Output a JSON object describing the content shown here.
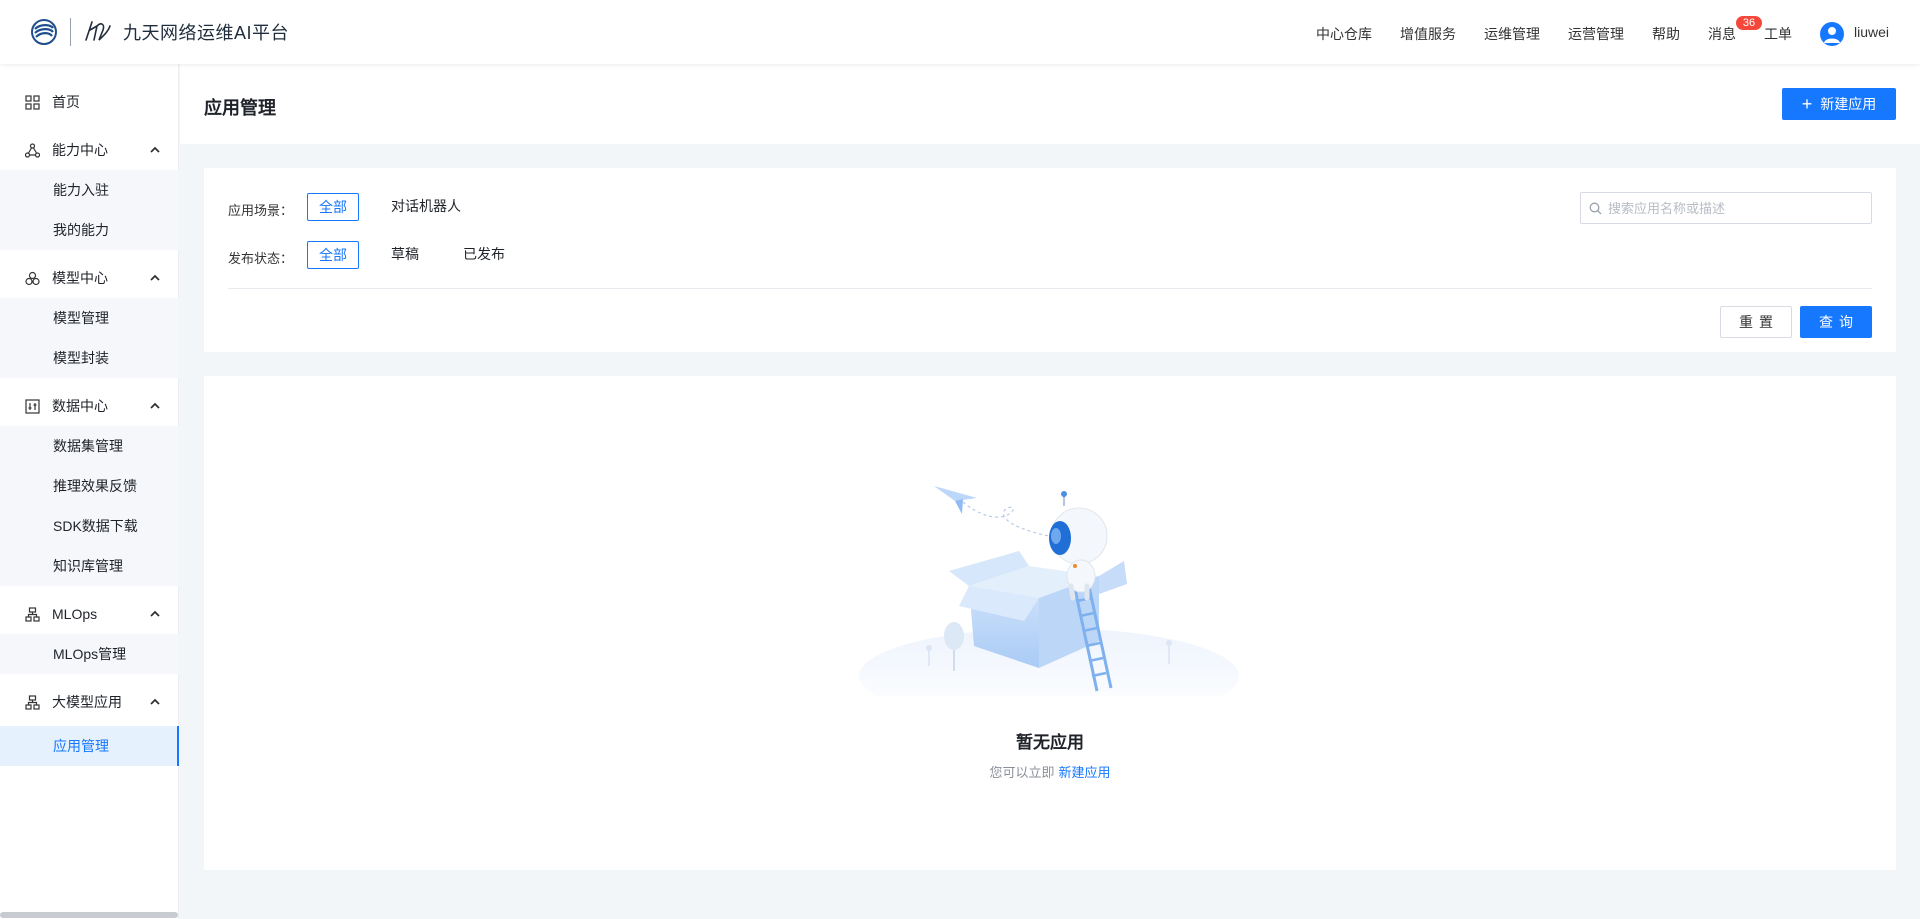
{
  "header": {
    "logo_text": "九天网络运维AI平台",
    "nav": [
      {
        "label": "中心仓库"
      },
      {
        "label": "增值服务"
      },
      {
        "label": "运维管理"
      },
      {
        "label": "运营管理"
      },
      {
        "label": "帮助"
      },
      {
        "label": "消息"
      },
      {
        "label": "工单"
      }
    ],
    "message_badge": "36",
    "username": "liuwei"
  },
  "sidebar": {
    "home": "首页",
    "groups": [
      {
        "label": "能力中心",
        "icon": "share-nodes-icon",
        "items": [
          "能力入驻",
          "我的能力"
        ]
      },
      {
        "label": "模型中心",
        "icon": "circles-icon",
        "items": [
          "模型管理",
          "模型封装"
        ]
      },
      {
        "label": "数据中心",
        "icon": "data-sliders-icon",
        "items": [
          "数据集管理",
          "推理效果反馈",
          "SDK数据下载",
          "知识库管理"
        ]
      },
      {
        "label": "MLOps",
        "icon": "hierarchy-icon",
        "items": [
          "MLOps管理"
        ]
      },
      {
        "label": "大模型应用",
        "icon": "hierarchy-icon",
        "items": [
          "应用管理"
        ]
      }
    ],
    "active_item": "应用管理"
  },
  "page": {
    "title": "应用管理",
    "new_button": "新建应用"
  },
  "filters": {
    "scene_label": "应用场景：",
    "scene_options": [
      "全部",
      "对话机器人"
    ],
    "scene_selected": "全部",
    "status_label": "发布状态：",
    "status_options": [
      "全部",
      "草稿",
      "已发布"
    ],
    "status_selected": "全部",
    "search_placeholder": "搜索应用名称或描述",
    "search_value": "",
    "reset_label": "重置",
    "query_label": "查询"
  },
  "empty": {
    "title": "暂无应用",
    "desc": "您可以立即",
    "link": "新建应用"
  },
  "colors": {
    "primary": "#1677ff",
    "badge": "#f5483b",
    "active_bg": "#e6f1fe",
    "page_bg": "#f3f6f9"
  }
}
